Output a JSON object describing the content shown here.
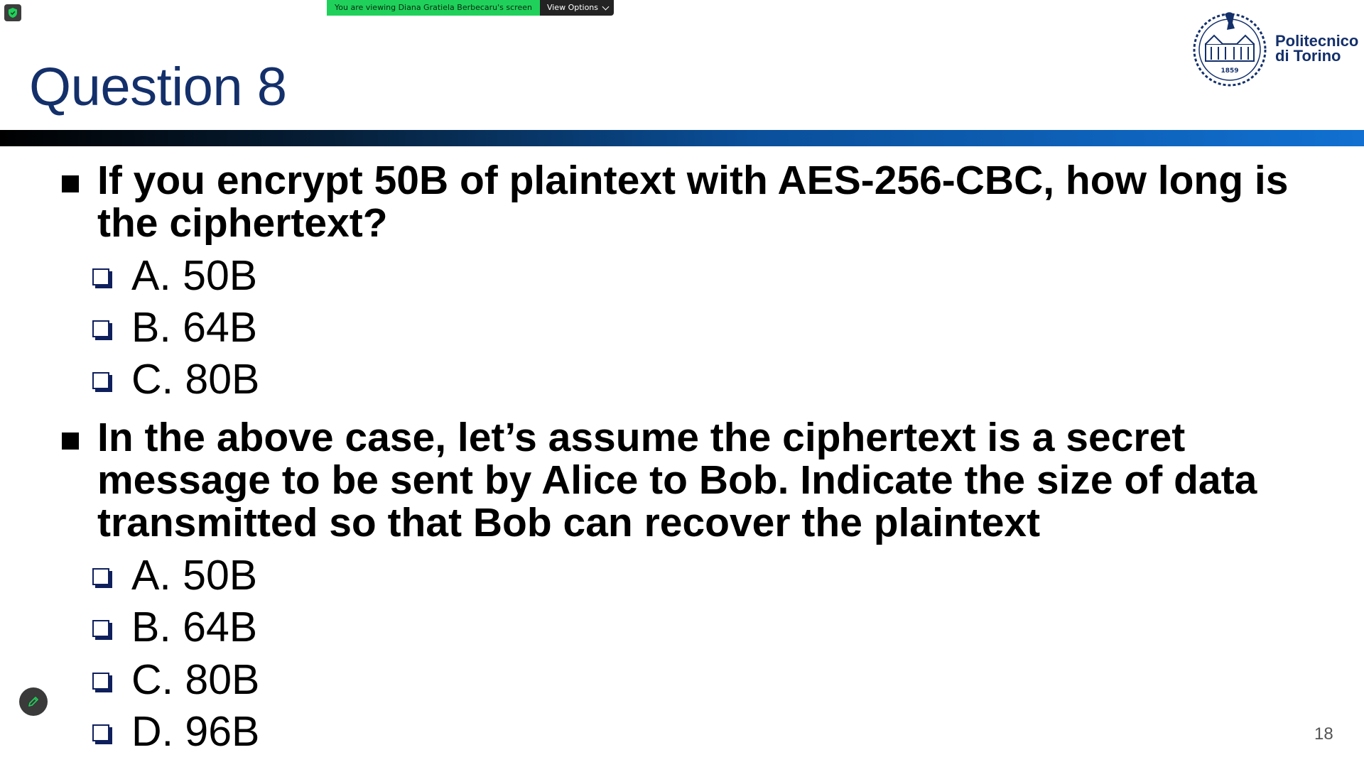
{
  "share_banner": {
    "text": "You are viewing Diana Gratiela Berbecaru's screen",
    "view_options_label": "View Options"
  },
  "slide": {
    "title": "Question 8",
    "logo": {
      "line1": "Politecnico",
      "line2": "di Torino",
      "seal_year": "1859"
    },
    "questions": [
      {
        "text": "If you encrypt 50B of plaintext with AES-256-CBC, how long is the ciphertext?",
        "options": [
          "A. 50B",
          "B. 64B",
          "C. 80B"
        ]
      },
      {
        "text": "In the above case, let’s assume the ciphertext is a secret message to be sent by Alice to Bob. Indicate the size of data transmitted so that Bob can recover the plaintext",
        "options": [
          "A. 50B",
          "B. 64B",
          "C. 80B",
          "D. 96B"
        ]
      }
    ],
    "page_number": "18"
  },
  "colors": {
    "title": "#14306b",
    "banner_green": "#1fd15a",
    "bar_start": "#000000",
    "bar_end": "#1170d1"
  },
  "icons": [
    "shield-icon",
    "chevron-down-icon",
    "pencil-icon",
    "seal-icon"
  ]
}
